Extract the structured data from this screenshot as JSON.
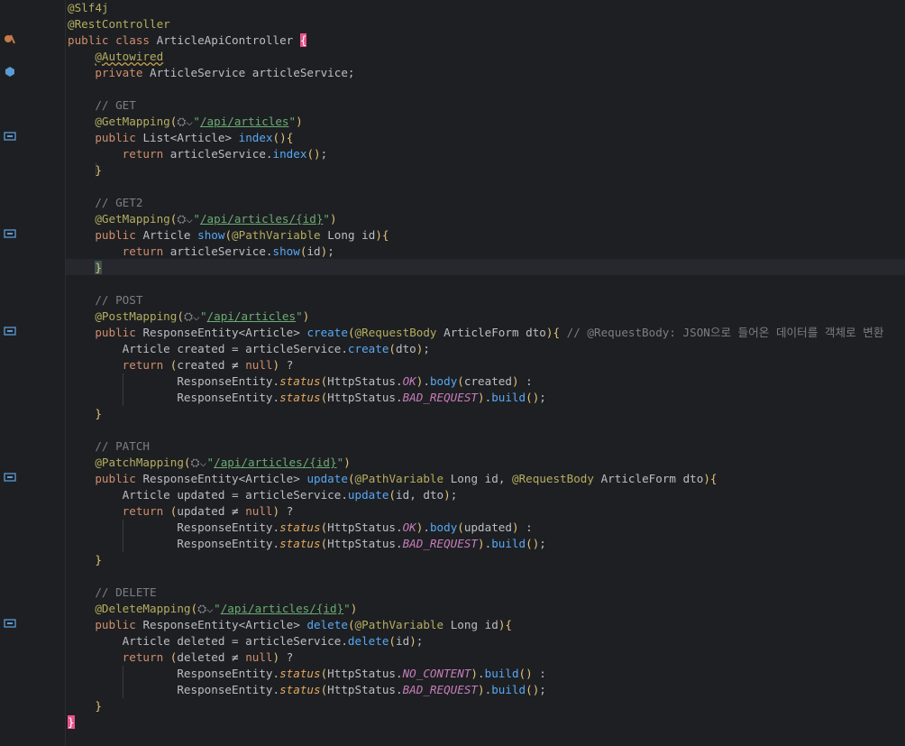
{
  "editor": {
    "lines": [
      "@Slf4j",
      "@RestController",
      "public class ArticleApiController {",
      "    @Autowired",
      "    private ArticleService articleService;",
      "",
      "    // GET",
      "    @GetMapping(\"/api/articles\")",
      "    public List<Article> index(){",
      "        return articleService.index();",
      "    }",
      "",
      "    // GET2",
      "    @GetMapping(\"/api/articles/{id}\")",
      "    public Article show(@PathVariable Long id){",
      "        return articleService.show(id);",
      "    }",
      "",
      "    // POST",
      "    @PostMapping(\"/api/articles\")",
      "    public ResponseEntity<Article> create(@RequestBody ArticleForm dto){ // @RequestBody: JSON으로 들어온 데이터를 객체로 변환",
      "        Article created = articleService.create(dto);",
      "        return (created ≠ null) ?",
      "                ResponseEntity.status(HttpStatus.OK).body(created) :",
      "                ResponseEntity.status(HttpStatus.BAD_REQUEST).build();",
      "    }",
      "",
      "    // PATCH",
      "    @PatchMapping(\"/api/articles/{id}\")",
      "    public ResponseEntity<Article> update(@PathVariable Long id, @RequestBody ArticleForm dto){",
      "        Article updated = articleService.update(id, dto);",
      "        return (updated ≠ null) ?",
      "                ResponseEntity.status(HttpStatus.OK).body(updated) :",
      "                ResponseEntity.status(HttpStatus.BAD_REQUEST).build();",
      "    }",
      "",
      "    // DELETE",
      "    @DeleteMapping(\"/api/articles/{id}\")",
      "    public ResponseEntity<Article> delete(@PathVariable Long id){",
      "        Article deleted = articleService.delete(id);",
      "        return (deleted ≠ null) ?",
      "                ResponseEntity.status(HttpStatus.NO_CONTENT).build() :",
      "                ResponseEntity.status(HttpStatus.BAD_REQUEST).build();",
      "    }",
      "}"
    ],
    "gutter_icons": [
      {
        "line": 3,
        "icon": "spring-bean-icon"
      },
      {
        "line": 5,
        "icon": "autowired-bean-icon"
      },
      {
        "line": 9,
        "icon": "endpoint-icon"
      },
      {
        "line": 15,
        "icon": "endpoint-icon"
      },
      {
        "line": 21,
        "icon": "endpoint-icon"
      },
      {
        "line": 30,
        "icon": "endpoint-icon"
      },
      {
        "line": 39,
        "icon": "endpoint-icon"
      }
    ],
    "current_line": 17,
    "colors": {
      "background": "#1e1f22",
      "keyword": "#cf8e6d",
      "annotation": "#b3ae60",
      "string": "#6aab73",
      "comment": "#7a7e85",
      "method": "#56a8f5",
      "constant": "#c77dbb",
      "text": "#bcbec4",
      "brace_match": "#e8528a"
    }
  }
}
